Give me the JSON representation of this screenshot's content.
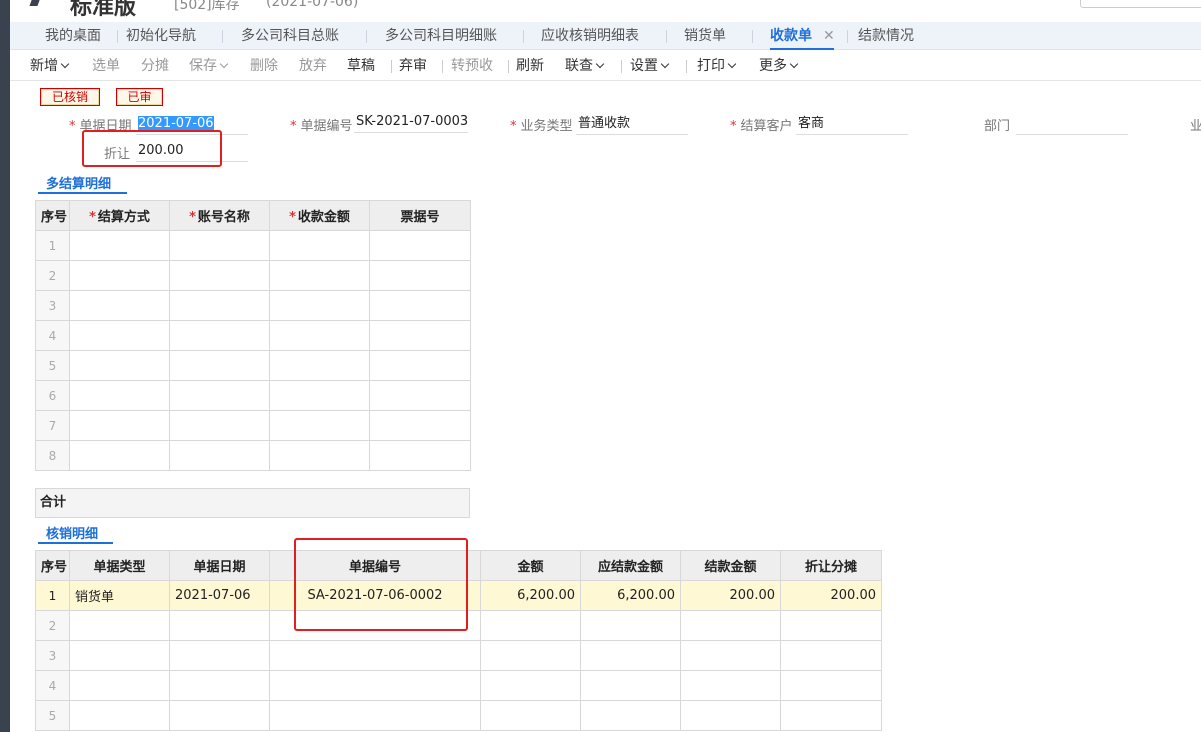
{
  "app": {
    "title": "标准版",
    "org": "[502]库存",
    "date": "(2021-07-06)"
  },
  "tabs": [
    {
      "label": "我的桌面"
    },
    {
      "label": "初始化导航"
    },
    {
      "label": "多公司科目总账"
    },
    {
      "label": "多公司科目明细账"
    },
    {
      "label": "应收核销明细表"
    },
    {
      "label": "销货单"
    },
    {
      "label": "收款单",
      "active": true
    },
    {
      "label": "结款情况"
    }
  ],
  "tab_close": "✕",
  "toolbar": {
    "xinzeng": "新增",
    "xuandan": "选单",
    "fentan": "分摊",
    "baocun": "保存",
    "shanchu": "删除",
    "fangqi": "放弃",
    "caogao": "草稿",
    "qishen": "弃审",
    "zhuanyushou": "转预收",
    "shuaxin": "刷新",
    "lianzha": "联查",
    "shezhi": "设置",
    "dayin": "打印",
    "gengduo": "更多"
  },
  "stamps": {
    "verified": "已核销",
    "audited": "已审"
  },
  "form": {
    "date_label": "单据日期",
    "date_value": "2021-07-06",
    "number_label": "单据编号",
    "number_value": "SK-2021-07-0003",
    "biztype_label": "业务类型",
    "biztype_value": "普通收款",
    "customer_label": "结算客户",
    "customer_value": "客商",
    "dept_label": "部门",
    "more_label": "业",
    "discount_label": "折让",
    "discount_value": "200.00"
  },
  "settlement": {
    "title": "多结算明细",
    "headers": [
      "序号",
      "结算方式",
      "账号名称",
      "收款金额",
      "票据号"
    ],
    "rows": [
      "1",
      "2",
      "3",
      "4",
      "5",
      "6",
      "7",
      "8"
    ],
    "summary": "合计"
  },
  "writeoff": {
    "title": "核销明细",
    "headers": [
      "序号",
      "单据类型",
      "单据日期",
      "单据编号",
      "金额",
      "应结款金额",
      "结款金额",
      "折让分摊"
    ],
    "row1": {
      "idx": "1",
      "type": "销货单",
      "date": "2021-07-06",
      "number": "SA-2021-07-06-0002",
      "amount": "6,200.00",
      "due": "6,200.00",
      "settled": "200.00",
      "discount": "200.00"
    },
    "empty_rows": [
      "2",
      "3",
      "4",
      "5"
    ]
  },
  "colors": {
    "accent": "#1e6fd9",
    "highlight": "#e02020",
    "row_highlight": "#fff8d4"
  }
}
